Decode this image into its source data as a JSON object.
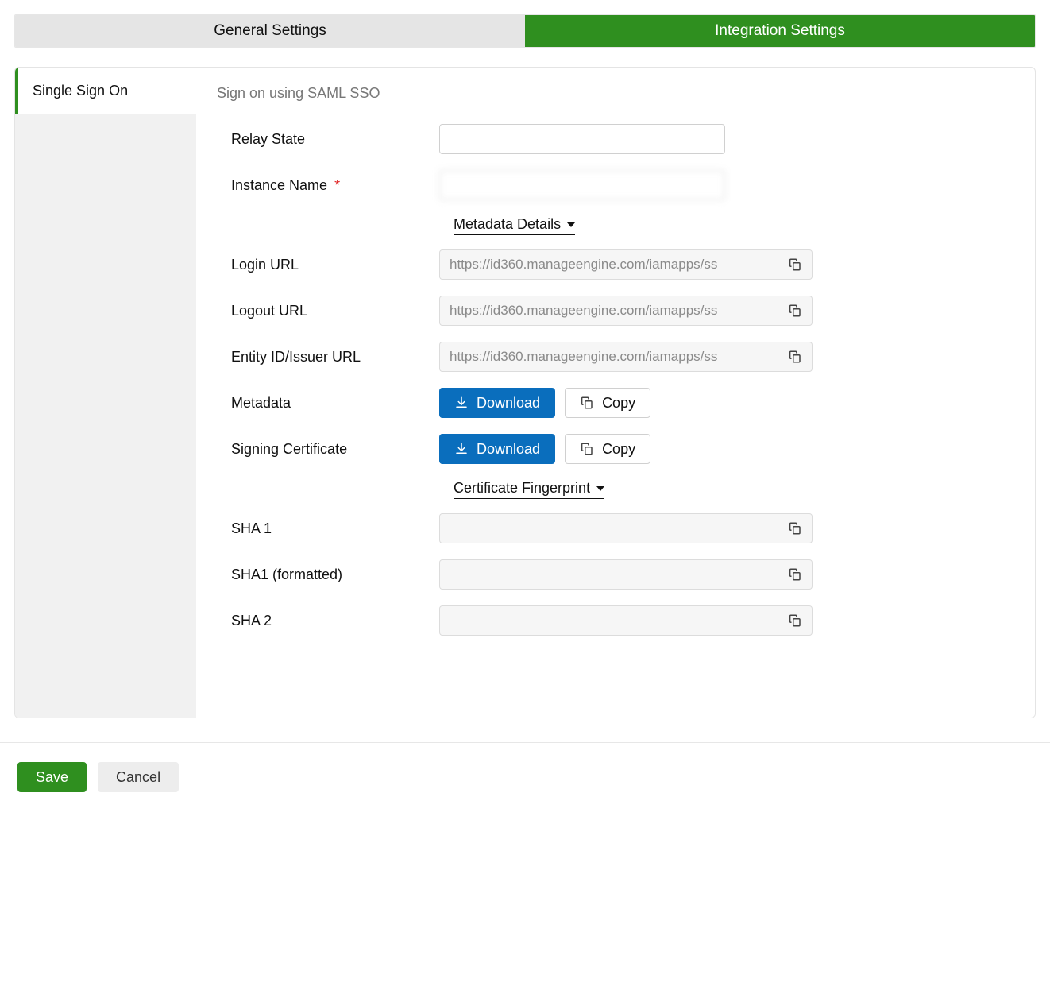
{
  "tabs": {
    "general": "General Settings",
    "integration": "Integration Settings"
  },
  "sidebar": {
    "items": [
      {
        "label": "Single Sign On"
      }
    ]
  },
  "section_title": "Sign on using SAML SSO",
  "fields": {
    "relay_state": {
      "label": "Relay State",
      "value": ""
    },
    "instance_name": {
      "label": "Instance Name",
      "required": "*",
      "value": ""
    },
    "metadata_details_heading": "Metadata Details",
    "login_url": {
      "label": "Login URL",
      "value": "https://id360.manageengine.com/iamapps/ss"
    },
    "logout_url": {
      "label": "Logout URL",
      "value": "https://id360.manageengine.com/iamapps/ss"
    },
    "entity_id": {
      "label": "Entity ID/Issuer URL",
      "value": "https://id360.manageengine.com/iamapps/ss"
    },
    "metadata": {
      "label": "Metadata"
    },
    "signing_cert": {
      "label": "Signing Certificate"
    },
    "cert_fingerprint_heading": "Certificate Fingerprint",
    "sha1": {
      "label": "SHA 1",
      "value": ""
    },
    "sha1_fmt": {
      "label": "SHA1 (formatted)",
      "value": ""
    },
    "sha2": {
      "label": "SHA 2",
      "value": ""
    }
  },
  "buttons": {
    "download": "Download",
    "copy": "Copy",
    "save": "Save",
    "cancel": "Cancel"
  }
}
